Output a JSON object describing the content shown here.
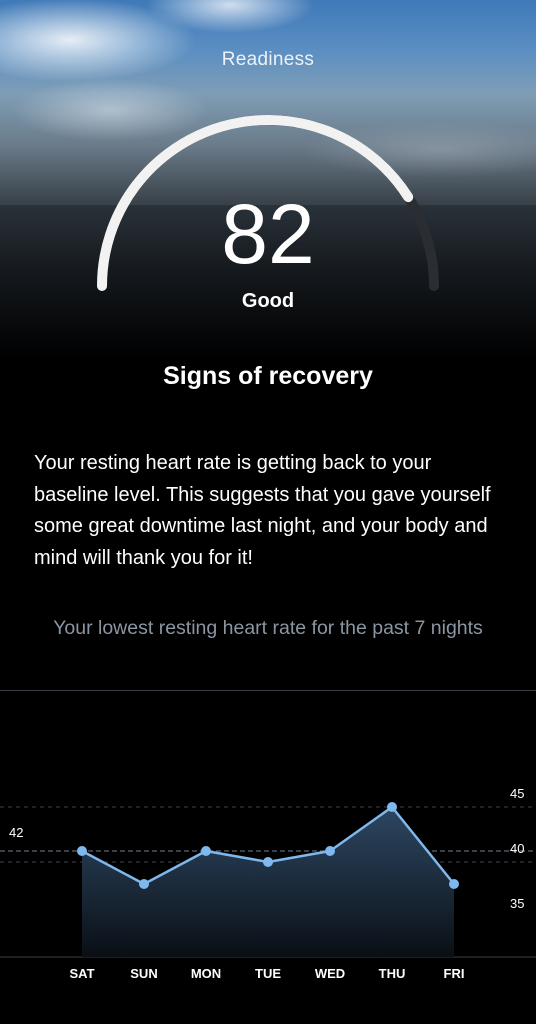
{
  "header": {
    "title": "Readiness"
  },
  "score": {
    "value": "82",
    "label": "Good",
    "max": 100
  },
  "headline": "Signs of recovery",
  "body": "Your resting heart rate is getting back to your baseline level. This suggests that you gave yourself some great downtime last night, and your body and mind will thank you for it!",
  "chart_caption": "Your lowest resting heart rate for the past 7 nights",
  "colors": {
    "accent": "#7fb8ee",
    "gauge_track": "#2a2e33",
    "gauge_fill": "#f2f2f2"
  },
  "chart_data": {
    "type": "area",
    "categories": [
      "SAT",
      "SUN",
      "MON",
      "TUE",
      "WED",
      "THU",
      "FRI"
    ],
    "series": [
      {
        "values": [
          41,
          38,
          41,
          40,
          41,
          45,
          38
        ]
      }
    ],
    "ylim": [
      35,
      45
    ],
    "yticks": [
      35,
      40,
      45
    ],
    "reference_line": {
      "value": 41,
      "label": "42"
    },
    "title": "",
    "xlabel": "",
    "ylabel": ""
  }
}
